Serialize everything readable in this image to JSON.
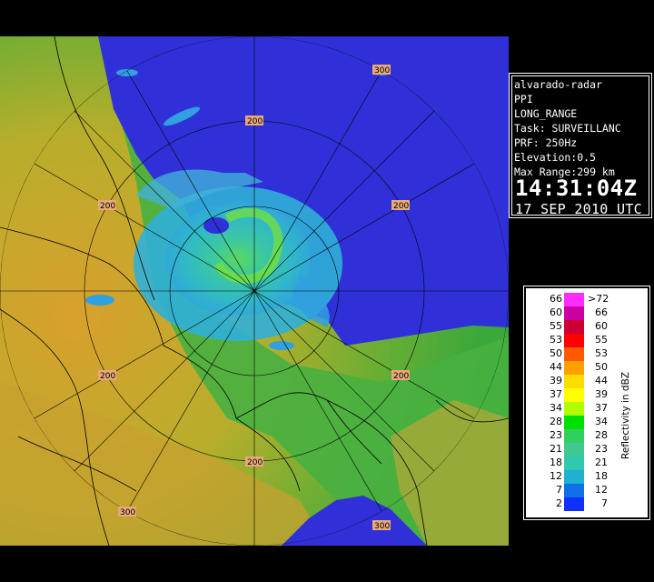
{
  "radar": {
    "site": "alvarado-radar",
    "product": "PPI",
    "mode": "LONG_RANGE",
    "task": "Task: SURVEILLANC",
    "prf": "PRF: 250Hz",
    "elevation": "Elevation:0.5",
    "max_range": "Max Range:299 km",
    "time": "14:31:04Z",
    "date": "17 SEP 2010 UTC"
  },
  "range_labels": {
    "r200_a": "200",
    "r200_b": "200",
    "r200_c": "200",
    "r200_d": "200",
    "r200_e": "200",
    "r300_a": "300",
    "r300_b": "300"
  },
  "legend": {
    "title": "Reflectivity in dBZ",
    "bins": [
      {
        "low": "66",
        "high": ">72",
        "color": "#ff2cff"
      },
      {
        "low": "60",
        "high": "66",
        "color": "#cc00a0"
      },
      {
        "low": "55",
        "high": "60",
        "color": "#cc0033"
      },
      {
        "low": "53",
        "high": "55",
        "color": "#ff0000"
      },
      {
        "low": "50",
        "high": "53",
        "color": "#ff5a00"
      },
      {
        "low": "44",
        "high": "50",
        "color": "#ffa000"
      },
      {
        "low": "39",
        "high": "44",
        "color": "#ffdd00"
      },
      {
        "low": "37",
        "high": "39",
        "color": "#ffff00"
      },
      {
        "low": "34",
        "high": "37",
        "color": "#b0ff00"
      },
      {
        "low": "28",
        "high": "34",
        "color": "#00e000"
      },
      {
        "low": "23",
        "high": "28",
        "color": "#30d060"
      },
      {
        "low": "21",
        "high": "23",
        "color": "#40c890"
      },
      {
        "low": "18",
        "high": "21",
        "color": "#30c8b0"
      },
      {
        "low": "12",
        "high": "18",
        "color": "#20b0d0"
      },
      {
        "low": "7",
        "high": "12",
        "color": "#1070e8"
      },
      {
        "low": "2",
        "high": "7",
        "color": "#1030ff"
      }
    ]
  },
  "colors": {
    "ocean": "#3030d8",
    "land_low": "#3aa83a",
    "land_high": "#d8a030"
  }
}
